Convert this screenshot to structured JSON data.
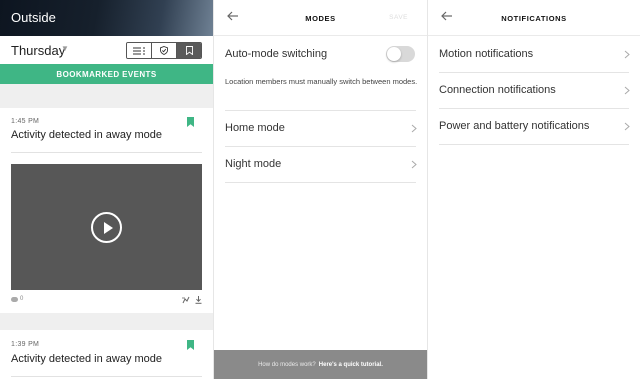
{
  "location_screen": {
    "title": "Outside",
    "day_selector": {
      "label": "Thursday"
    },
    "filter_bar": {
      "label": "BOOKMARKED EVENTS"
    },
    "events": [
      {
        "time": "1:45 PM",
        "title": "Activity detected in away mode",
        "comment_count": "0"
      },
      {
        "time": "1:39 PM",
        "title": "Activity detected in away mode"
      }
    ]
  },
  "modes_screen": {
    "title": "MODES",
    "save_label": "SAVE",
    "auto_switch": {
      "label": "Auto-mode switching",
      "enabled": false,
      "help": "Location members must manually switch between modes."
    },
    "modes": [
      {
        "label": "Home mode"
      },
      {
        "label": "Night mode"
      }
    ],
    "footer": {
      "text": "How do modes work?",
      "link": "Here's a quick tutorial."
    }
  },
  "notifications_screen": {
    "title": "NOTIFICATIONS",
    "items": [
      {
        "label": "Motion notifications"
      },
      {
        "label": "Connection notifications"
      },
      {
        "label": "Power and battery notifications"
      }
    ]
  },
  "colors": {
    "accent_green": "#3fb685",
    "video_bg": "#575757",
    "footer_bg": "#8a8a8a"
  }
}
